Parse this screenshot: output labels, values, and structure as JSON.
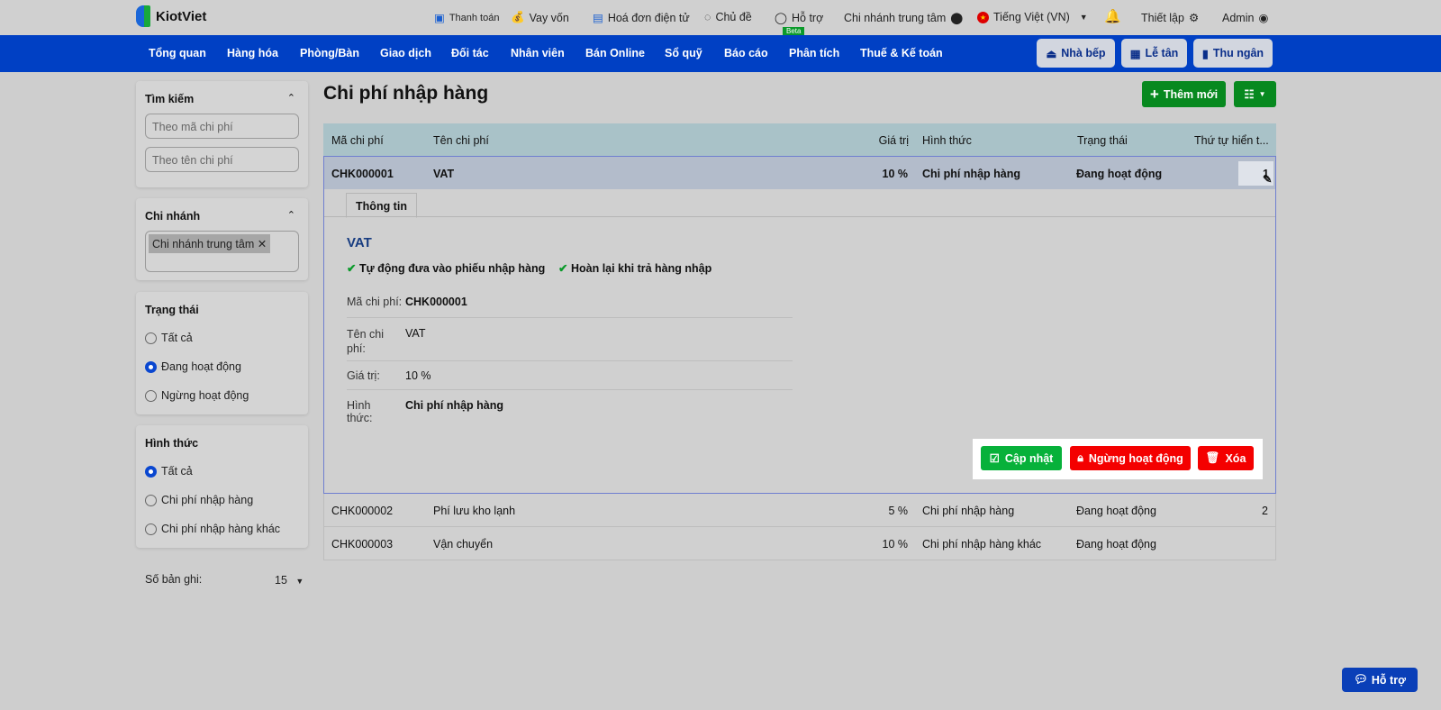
{
  "app": {
    "logo": "KiotViet"
  },
  "topbar": {
    "payment": "Thanh toán",
    "loan": "Vay vốn",
    "einvoice": "Hoá đơn điện tử",
    "theme": "Chủ đề",
    "support": "Hỗ trợ",
    "beta": "Beta",
    "branch": "Chi nhánh trung tâm",
    "language": "Tiếng Việt (VN)",
    "settings": "Thiết lập",
    "user": "Admin"
  },
  "nav": {
    "items": [
      "Tổng quan",
      "Hàng hóa",
      "Phòng/Bàn",
      "Giao dịch",
      "Đối tác",
      "Nhân viên",
      "Bán Online",
      "Sổ quỹ",
      "Báo cáo",
      "Phân tích",
      "Thuế & Kế toán"
    ],
    "kitchen": "Nhà bếp",
    "reception": "Lễ tân",
    "cashier": "Thu ngân"
  },
  "sidebar": {
    "search": {
      "title": "Tìm kiếm",
      "code_placeholder": "Theo mã chi phí",
      "name_placeholder": "Theo tên chi phí"
    },
    "branch": {
      "title": "Chi nhánh",
      "tag": "Chi nhánh trung tâm"
    },
    "status": {
      "title": "Trạng thái",
      "options": [
        "Tất cả",
        "Đang hoạt động",
        "Ngừng hoạt động"
      ],
      "selected": 1
    },
    "type": {
      "title": "Hình thức",
      "options": [
        "Tất cả",
        "Chi phí nhập hàng",
        "Chi phí nhập hàng khác"
      ],
      "selected": 0
    },
    "records": {
      "label": "Số bản ghi:",
      "value": "15"
    }
  },
  "main": {
    "title": "Chi phí nhập hàng",
    "add_button": "Thêm mới",
    "columns": [
      "Mã chi phí",
      "Tên chi phí",
      "Giá trị",
      "Hình thức",
      "Trạng thái",
      "Thứ tự hiển t..."
    ],
    "rows": [
      {
        "code": "CHK000001",
        "name": "VAT",
        "value": "10 %",
        "type": "Chi phí nhập hàng",
        "status": "Đang hoạt động",
        "order": "1"
      },
      {
        "code": "CHK000002",
        "name": "Phí lưu kho lạnh",
        "value": "5 %",
        "type": "Chi phí nhập hàng",
        "status": "Đang hoạt động",
        "order": "2"
      },
      {
        "code": "CHK000003",
        "name": "Vận chuyển",
        "value": "10 %",
        "type": "Chi phí nhập hàng khác",
        "status": "Đang hoạt động",
        "order": ""
      }
    ],
    "detail": {
      "tab": "Thông tin",
      "heading": "VAT",
      "check1": "Tự động đưa vào phiếu nhập hàng",
      "check2": "Hoàn lại khi trả hàng nhập",
      "fields": [
        {
          "k": "Mã chi phí:",
          "v": "CHK000001"
        },
        {
          "k": "Tên chi phí:",
          "v": "VAT"
        },
        {
          "k": "Giá trị:",
          "v": "10 %"
        },
        {
          "k": "Hình thức:",
          "v": "Chi phí nhập hàng"
        }
      ],
      "update": "Cập nhật",
      "deactivate": "Ngừng hoạt động",
      "delete": "Xóa"
    }
  },
  "help_button": "Hỗ trợ"
}
